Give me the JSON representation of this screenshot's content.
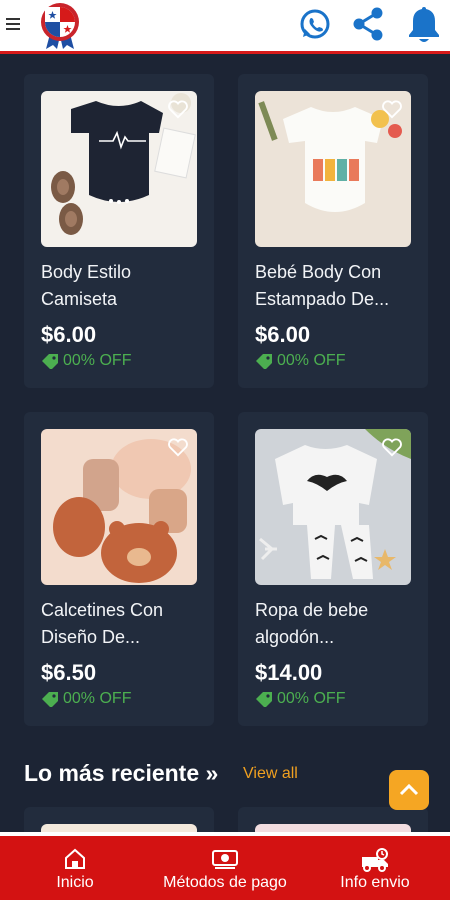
{
  "header": {
    "menu_icon": "hamburger-icon",
    "logo": "panama-flag-badge-logo",
    "icons": [
      "whatsapp-icon",
      "share-icon",
      "bell-icon"
    ]
  },
  "products": [
    {
      "name": "Body Estilo\nCamiseta",
      "price": "$6.00",
      "discount": "00% OFF"
    },
    {
      "name": "Bebé Body Con\nEstampado De...",
      "price": "$6.00",
      "discount": "00% OFF"
    },
    {
      "name": "Calcetines Con\nDiseño De...",
      "price": "$6.50",
      "discount": "00% OFF"
    },
    {
      "name": "Ropa de bebe\nalgodón...",
      "price": "$14.00",
      "discount": "00% OFF"
    }
  ],
  "recent": {
    "title": "Lo más reciente »",
    "view_all": "View all"
  },
  "bottom_nav": [
    {
      "label": "Inicio",
      "icon": "home-icon"
    },
    {
      "label": "Métodos de pago",
      "icon": "money-icon"
    },
    {
      "label": "Info envio",
      "icon": "delivery-truck-icon"
    }
  ],
  "colors": {
    "background": "#1c2434",
    "card": "#222c3d",
    "accent_red": "#d31212",
    "discount_green": "#4caf50",
    "view_all_orange": "#f0a020",
    "whatsapp_blue": "#1a73c9"
  }
}
